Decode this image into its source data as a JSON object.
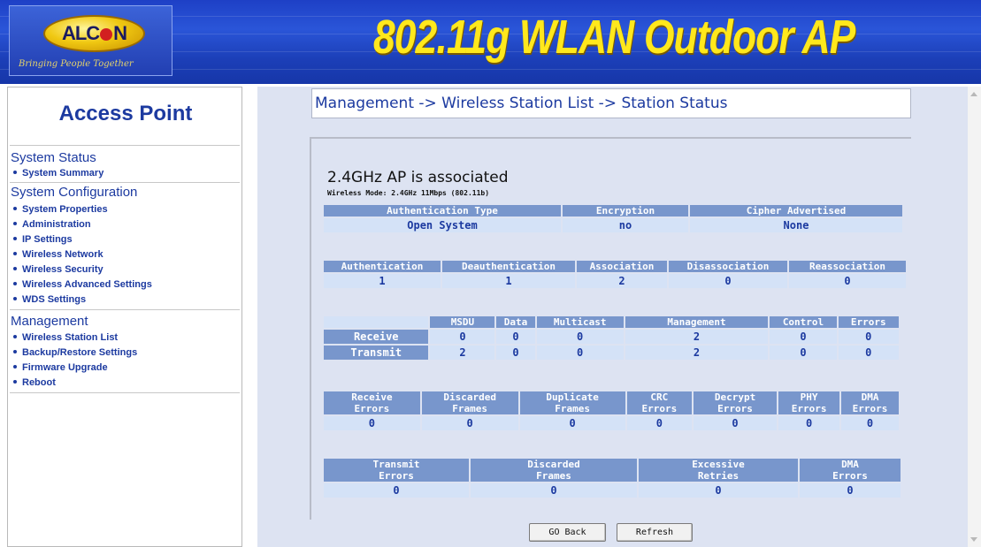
{
  "header": {
    "logo": {
      "brand": "ALC",
      "brand_end": "N",
      "tagline": "Bringing People Together"
    },
    "title": "802.11g WLAN Outdoor AP"
  },
  "sidebar": {
    "title": "Access Point",
    "sections": [
      {
        "label": "System Status",
        "items": [
          "System Summary"
        ]
      },
      {
        "label": "System Configuration",
        "items": [
          "System Properties",
          "Administration",
          "IP Settings",
          "Wireless Network",
          "Wireless Security",
          "Wireless Advanced Settings",
          "WDS Settings"
        ]
      },
      {
        "label": "Management",
        "items": [
          "Wireless Station List",
          "Backup/Restore Settings",
          "Firmware Upgrade",
          "Reboot"
        ]
      }
    ]
  },
  "breadcrumb": "Management -> Wireless Station List -> Station Status",
  "status": {
    "heading": "2.4GHz AP is  associated",
    "wireless_mode": "Wireless Mode: 2.4GHz 11Mbps (802.11b)"
  },
  "tables": {
    "auth": {
      "headers": [
        "Authentication Type",
        "Encryption",
        "Cipher Advertised"
      ],
      "values": [
        "Open System",
        "no",
        "None"
      ]
    },
    "counts": {
      "headers": [
        "Authentication",
        "Deauthentication",
        "Association",
        "Disassociation",
        "Reassociation"
      ],
      "values": [
        "1",
        "1",
        "2",
        "0",
        "0"
      ]
    },
    "traffic": {
      "headers": [
        "MSDU",
        "Data",
        "Multicast",
        "Management",
        "Control",
        "Errors"
      ],
      "rows": [
        {
          "label": "Receive",
          "values": [
            "0",
            "0",
            "0",
            "2",
            "0",
            "0"
          ]
        },
        {
          "label": "Transmit",
          "values": [
            "2",
            "0",
            "0",
            "2",
            "0",
            "0"
          ]
        }
      ]
    },
    "rx_errors": {
      "headers": [
        [
          "Receive",
          "Errors"
        ],
        [
          "Discarded",
          "Frames"
        ],
        [
          "Duplicate",
          "Frames"
        ],
        [
          "CRC",
          "Errors"
        ],
        [
          "Decrypt",
          "Errors"
        ],
        [
          "PHY",
          "Errors"
        ],
        [
          "DMA",
          "Errors"
        ]
      ],
      "values": [
        "0",
        "0",
        "0",
        "0",
        "0",
        "0",
        "0"
      ]
    },
    "tx_errors": {
      "headers": [
        [
          "Transmit",
          "Errors"
        ],
        [
          "Discarded",
          "Frames"
        ],
        [
          "Excessive",
          "Retries"
        ],
        [
          "DMA",
          "Errors"
        ]
      ],
      "values": [
        "0",
        "0",
        "0",
        "0"
      ]
    }
  },
  "buttons": {
    "back": "GO Back",
    "refresh": "Refresh"
  },
  "colors": {
    "header_bg": "#1e40c6",
    "title_yellow": "#ffe81c",
    "nav_blue": "#1c3aa0",
    "table_header": "#7896cc",
    "table_cell": "#d4e2f7",
    "content_bg": "#dde3f2"
  }
}
